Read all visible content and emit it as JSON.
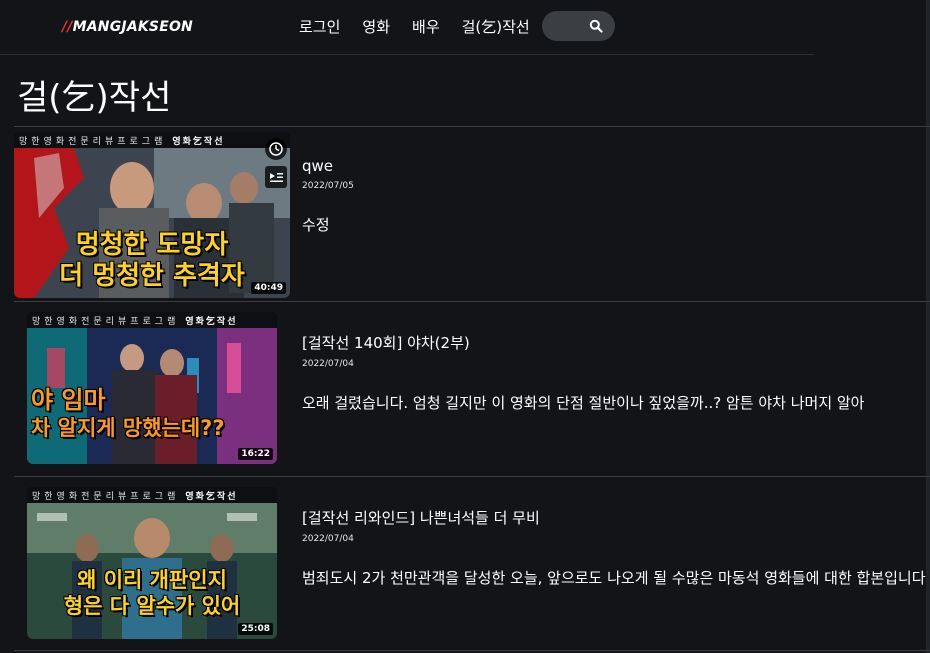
{
  "header": {
    "logo_slash": "//",
    "logo_text": "MANGJAKSEON",
    "nav": [
      "로그인",
      "영화",
      "배우",
      "걸(乞)작선"
    ],
    "search_placeholder": "",
    "search_icon": "search-icon"
  },
  "page_title": "걸(乞)작선",
  "thumb_strip": {
    "program": "망한영화전문리뷰프로그램",
    "brand": "영화乞작선"
  },
  "videos": [
    {
      "title": "qwe",
      "date": "2022/07/05",
      "description": "수정",
      "thumb_caption_line1": "멍청한 도망자",
      "thumb_caption_line2": "더 멍청한 추격자",
      "duration": "40:49",
      "icons": [
        "clock-icon",
        "playlist-icon"
      ]
    },
    {
      "title": "[걸작선 140회] 야차(2부)",
      "date": "2022/07/04",
      "description": "오래 걸렸습니다. 엄청 길지만 이 영화의 단점 절반이나 짚었을까..? 암튼 야차 나머지 알아",
      "thumb_caption_line1": "야 임마",
      "thumb_caption_line2": "차 알지게 망했는데??",
      "duration": "16:22"
    },
    {
      "title": "[걸작선 리와인드] 나쁜녀석들 더 무비",
      "date": "2022/07/04",
      "description": "범죄도시 2가 천만관객을 달성한 오늘, 앞으로도 나오게 될 수많은 마동석 영화들에 대한 합본입니다",
      "thumb_caption_line1": "왜 이리 개판인지",
      "thumb_caption_line2": "형은 다 알수가 있어",
      "duration": "25:08"
    }
  ],
  "colors": {
    "background": "#121418",
    "logo_accent": "#e0352b",
    "caption_yellow": "#ffd21e",
    "divider": "#3a3d42"
  }
}
